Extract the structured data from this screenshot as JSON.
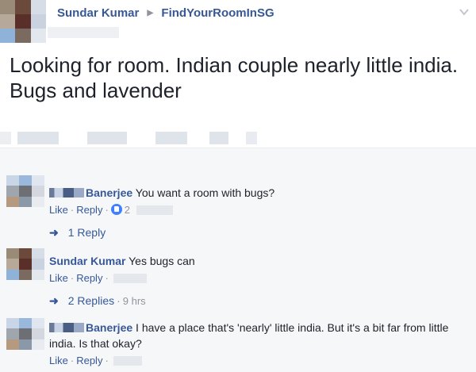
{
  "post": {
    "author": "Sundar Kumar",
    "group": "FindYourRoomInSG",
    "text": "Looking for room. Indian couple nearly little india. Bugs and lavender"
  },
  "comments": [
    {
      "name_visible": "Banerjee",
      "text": "You want a room with bugs?",
      "like_label": "Like",
      "reply_label": "Reply",
      "reaction_count": "2",
      "replies_label": "1 Reply"
    },
    {
      "name": "Sundar Kumar",
      "text": "Yes bugs can",
      "like_label": "Like",
      "reply_label": "Reply",
      "replies_label": "2 Replies",
      "replies_time": "9 hrs"
    },
    {
      "name_visible": "Banerjee",
      "text": "I have a place that's 'nearly' little india. But it's a bit far from little india. Is that okay?",
      "like_label": "Like",
      "reply_label": "Reply"
    }
  ],
  "colors": {
    "link": "#365899",
    "meta": "#90949c",
    "comments_bg": "#f6f7f9",
    "like_blue": "#4080ff"
  },
  "icons": [
    "reply-arrow-icon",
    "like-reaction-icon",
    "chevron-down-icon"
  ]
}
